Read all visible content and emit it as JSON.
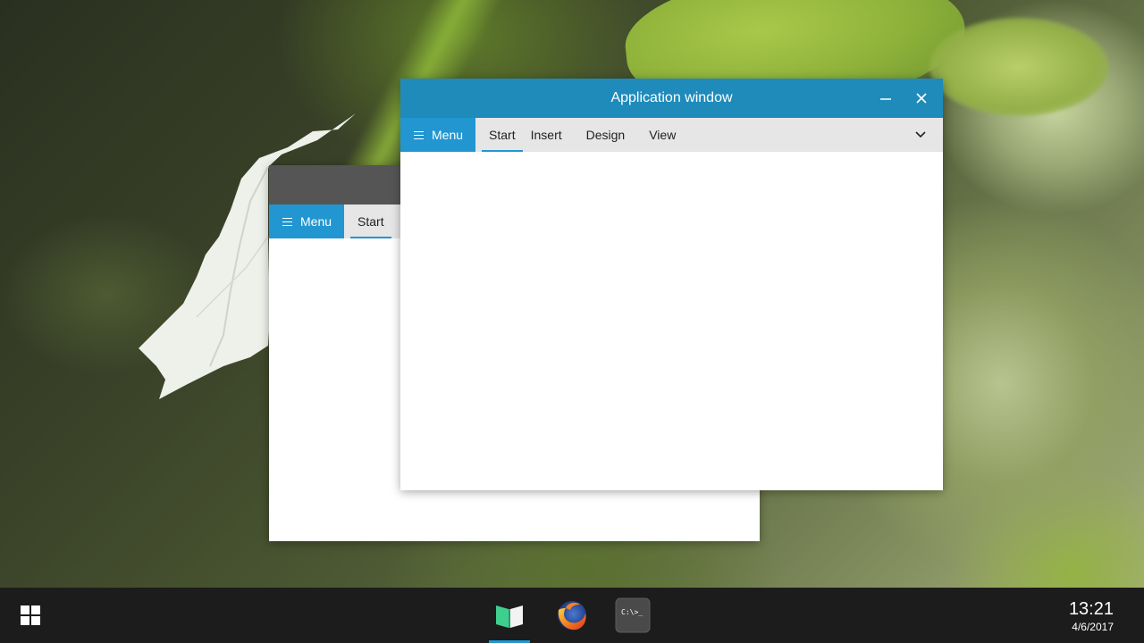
{
  "colors": {
    "accent": "#2196d1",
    "front_titlebar": "#1f8bbb",
    "back_titlebar": "#555555",
    "ribbon": "#e6e6e6",
    "taskbar": "#1c1c1c"
  },
  "back_window": {
    "title": "",
    "menu_label": "Menu",
    "tabs": [
      {
        "label": "Start",
        "active": true
      }
    ]
  },
  "front_window": {
    "title": "Application window",
    "menu_label": "Menu",
    "tabs": [
      {
        "label": "Start",
        "active": true
      },
      {
        "label": "Insert",
        "active": false
      },
      {
        "label": "Design",
        "active": false
      },
      {
        "label": "View",
        "active": false
      }
    ],
    "controls": [
      "minimize-icon",
      "close-icon"
    ],
    "ribbon_expand_icon": "chevron-down-icon"
  },
  "taskbar": {
    "start_icon": "windows-grid-icon",
    "apps": [
      {
        "name": "book-reader-icon",
        "active": true
      },
      {
        "name": "firefox-icon",
        "active": false
      },
      {
        "name": "terminal-icon",
        "label": "C:\\>_",
        "active": false
      }
    ],
    "clock": {
      "time": "13:21",
      "date": "4/6/2017"
    }
  }
}
